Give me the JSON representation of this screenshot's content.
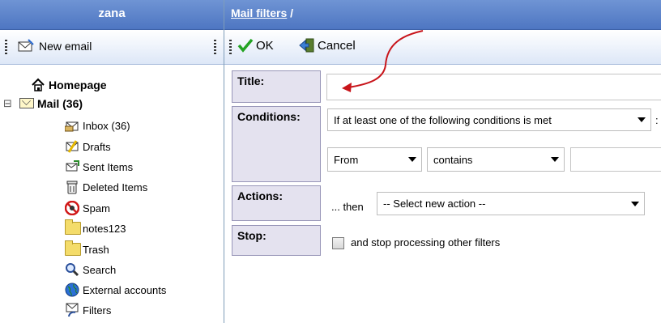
{
  "left": {
    "user": "zana",
    "new_email": "New email",
    "tree": {
      "homepage": "Homepage",
      "mail": "Mail (36)",
      "collapse_toggle": "⊟",
      "items": [
        {
          "label": "Inbox (36)",
          "icon": "inbox-icon"
        },
        {
          "label": "Drafts",
          "icon": "drafts-icon"
        },
        {
          "label": "Sent Items",
          "icon": "sent-items-icon"
        },
        {
          "label": "Deleted Items",
          "icon": "trash-can-icon"
        },
        {
          "label": "Spam",
          "icon": "spam-icon"
        },
        {
          "label": "notes123",
          "icon": "folder-icon"
        },
        {
          "label": "Trash",
          "icon": "folder-icon"
        },
        {
          "label": "Search",
          "icon": "search-icon"
        },
        {
          "label": "External accounts",
          "icon": "globe-icon"
        },
        {
          "label": "Filters",
          "icon": "filters-icon"
        }
      ]
    }
  },
  "right": {
    "breadcrumb": {
      "link": "Mail filters",
      "sep": " /"
    },
    "toolbar": {
      "ok": "OK",
      "cancel": "Cancel"
    },
    "form": {
      "title_label": "Title:",
      "title_value": "",
      "conditions_label": "Conditions:",
      "condition_mode": "If at least one of the following conditions is met",
      "condition_suffix": ":",
      "condition_field": "From",
      "condition_operator": "contains",
      "condition_value": "",
      "actions_label": "Actions:",
      "actions_then": "... then",
      "action_select": "-- Select new action --",
      "stop_label": "Stop:",
      "stop_text": "and stop processing other filters",
      "stop_checked": false
    }
  },
  "colors": {
    "header_blue": "#4e76c2",
    "label_bg": "#e4e2ef",
    "arrow_red": "#c8141a"
  }
}
